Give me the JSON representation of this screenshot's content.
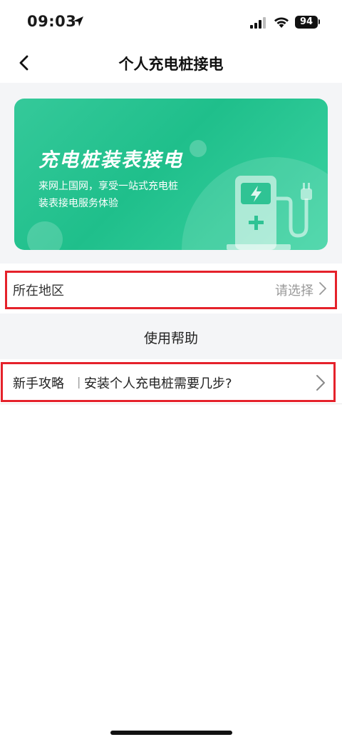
{
  "status_bar": {
    "time": "09:03",
    "battery": "94"
  },
  "nav": {
    "title": "个人充电桩接电"
  },
  "banner": {
    "title": "充电桩装表接电",
    "subtitle_line1": "来网上国网，享受一站式充电桩",
    "subtitle_line2": "装表接电服务体验"
  },
  "region": {
    "label": "所在地区",
    "placeholder": "请选择"
  },
  "help": {
    "title": "使用帮助",
    "guide": {
      "tag": "新手攻略",
      "separator": "|",
      "text": "安装个人充电桩需要几步?"
    }
  },
  "colors": {
    "accent_green": "#1fbf8b",
    "highlight_red": "#e5222b"
  }
}
